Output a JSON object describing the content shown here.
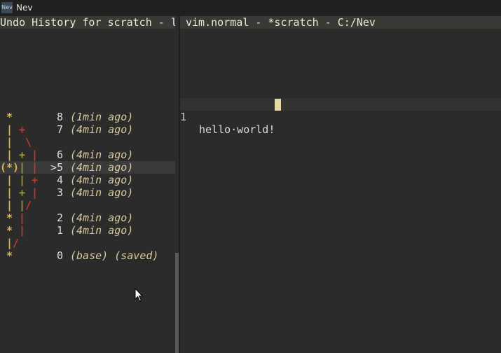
{
  "window": {
    "app_icon": "Nev",
    "title": "Nev"
  },
  "undo_panel": {
    "header": "Undo History for scratch - lo",
    "rows": [
      {
        "g1": "*",
        "num": "8",
        "time": "(1min ago)"
      },
      {
        "g1": "|",
        "g2": "+",
        "num": "7",
        "time": "(4min ago)"
      },
      {
        "g1": "|",
        "g3": "\\"
      },
      {
        "g1": "|",
        "g2": "+",
        "g4": "|",
        "num": "6",
        "time": "(4min ago)"
      },
      {
        "g0": "(*)",
        "g2": "|",
        "g4": "|",
        "num": ">5",
        "time": "(4min ago)",
        "current": true
      },
      {
        "g1": "|",
        "g2": "|",
        "g5": "+",
        "num": "4",
        "time": "(4min ago)"
      },
      {
        "g1": "|",
        "g2": "+",
        "g4": "|",
        "num": "3",
        "time": "(4min ago)"
      },
      {
        "g1": "|",
        "g2": "|",
        "g6": "/"
      },
      {
        "g1": "*",
        "g4": "|",
        "num": "2",
        "time": "(4min ago)"
      },
      {
        "g1": "*",
        "g4": "|",
        "num": "1",
        "time": "(4min ago)"
      },
      {
        "g1": "|",
        "g7": "/"
      },
      {
        "g1": "*",
        "num": "0",
        "time": "(base) (saved)"
      }
    ]
  },
  "editor": {
    "header": "vim.normal - *scratch - C:/Nev",
    "line_number": "1",
    "line_text": "hello·world!"
  }
}
